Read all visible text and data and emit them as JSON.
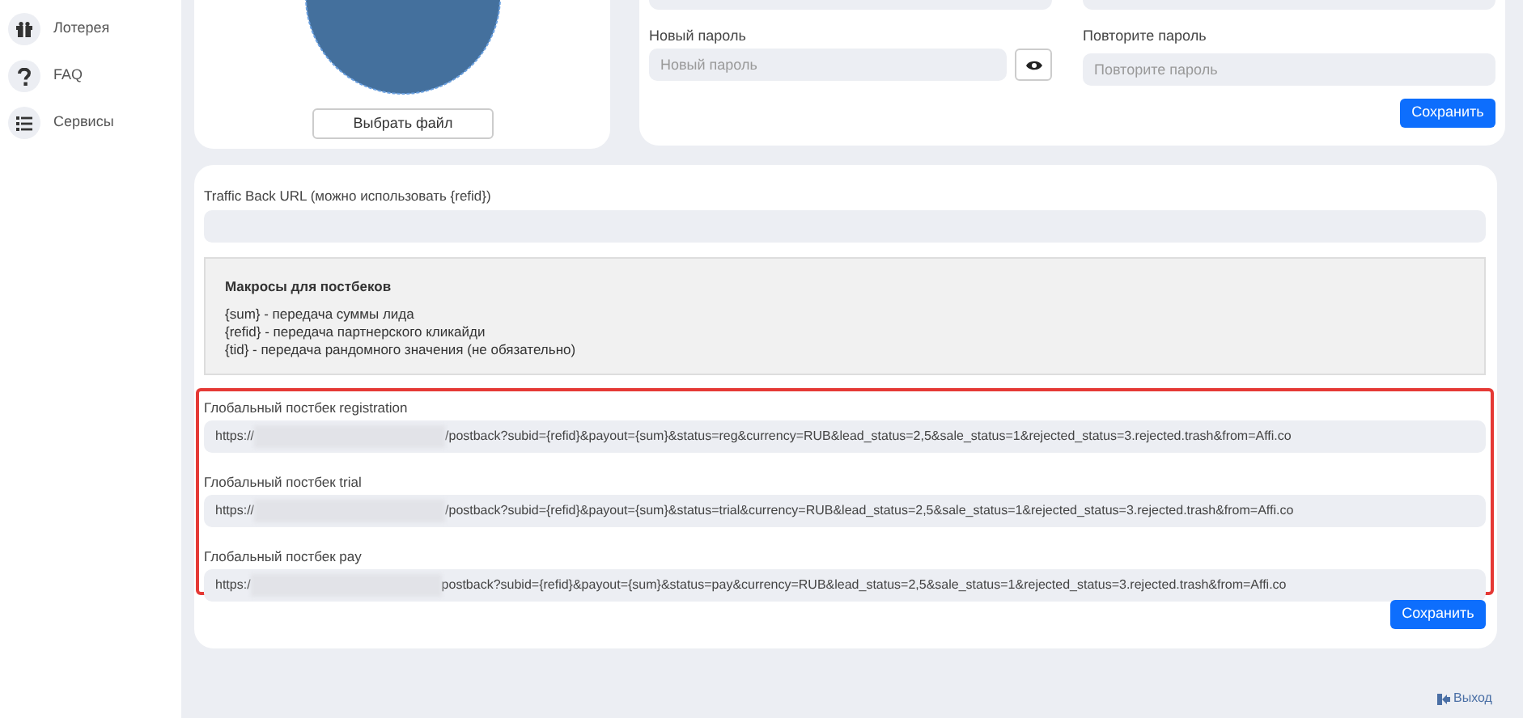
{
  "sidebar": {
    "items": [
      {
        "kind": "gift",
        "label": "Лотерея"
      },
      {
        "kind": "question",
        "label": "FAQ"
      },
      {
        "kind": "list",
        "label": "Сервисы"
      }
    ]
  },
  "avatar": {
    "button": "Выбрать файл"
  },
  "password": {
    "new_label": "Новый пароль",
    "new_placeholder": "Новый пароль",
    "repeat_label": "Повторите пароль",
    "repeat_placeholder": "Повторите пароль",
    "save": "Сохранить"
  },
  "settings": {
    "traffic_back_label": "Traffic Back URL (можно использовать {refid})",
    "macros_title": "Макросы для постбеков",
    "macros": [
      "{sum} - передача суммы лида",
      "{refid} - передача партнерского кликайди",
      "{tid} - передача рандомного значения (не обязательно)"
    ],
    "postbacks": [
      {
        "label": "Глобальный постбек registration",
        "prefix": "https://",
        "suffix": "/postback?subid={refid}&payout={sum}&status=reg&currency=RUB&lead_status=2,5&sale_status=1&rejected_status=3.rejected.trash&from=Affi.co"
      },
      {
        "label": "Глобальный постбек trial",
        "prefix": "https://",
        "suffix": "/postback?subid={refid}&payout={sum}&status=trial&currency=RUB&lead_status=2,5&sale_status=1&rejected_status=3.rejected.trash&from=Affi.co"
      },
      {
        "label": "Глобальный постбек pay",
        "prefix": "https:/",
        "suffix": "postback?subid={refid}&payout={sum}&status=pay&currency=RUB&lead_status=2,5&sale_status=1&rejected_status=3.rejected.trash&from=Affi.co"
      }
    ],
    "save": "Сохранить"
  },
  "logout": "Выход"
}
